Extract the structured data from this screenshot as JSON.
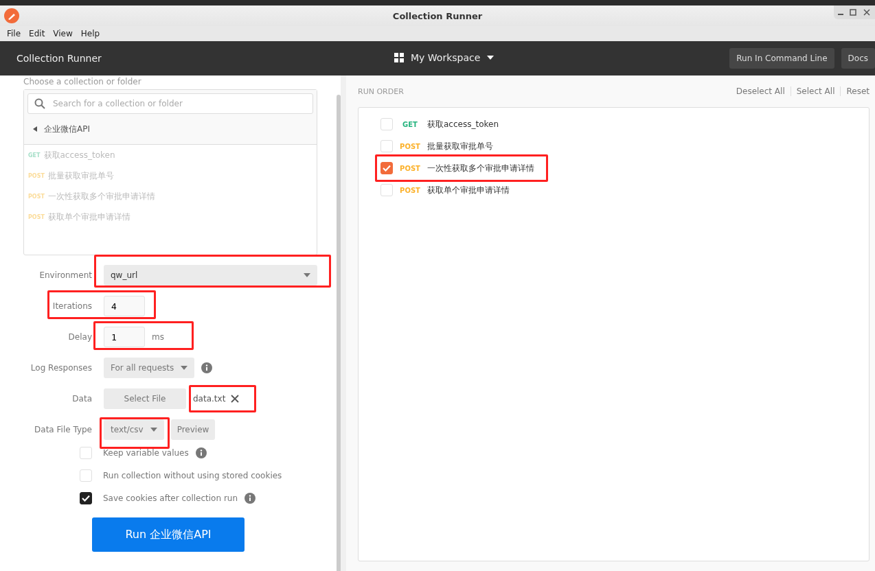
{
  "window": {
    "title": "Collection Runner"
  },
  "menu": [
    "File",
    "Edit",
    "View",
    "Help"
  ],
  "header": {
    "title": "Collection Runner",
    "workspace": "My Workspace",
    "buttons": [
      "Run In Command Line",
      "Docs"
    ]
  },
  "collection_picker": {
    "label": "Choose a collection or folder",
    "search_placeholder": "Search for a collection or folder",
    "collection": "企业微信API",
    "requests": [
      {
        "method": "GET",
        "name": "获取access_token"
      },
      {
        "method": "POST",
        "name": "批量获取审批单号"
      },
      {
        "method": "POST",
        "name": "一次性获取多个审批申请详情"
      },
      {
        "method": "POST",
        "name": "获取单个审批申请详情"
      }
    ]
  },
  "settings": [
    {
      "kind": "select",
      "label": "Environment",
      "value": "qw_url",
      "highlighted": true
    },
    {
      "kind": "number",
      "label": "Iterations",
      "value": "4",
      "highlighted": true
    },
    {
      "kind": "number",
      "label": "Delay",
      "value": "1",
      "unit": "ms",
      "highlighted": true
    },
    {
      "kind": "select_small",
      "label": "Log Responses",
      "value": "For all requests",
      "info": true,
      "highlighted": false
    },
    {
      "kind": "file",
      "label": "Data",
      "button": "Select File",
      "file": "data.txt",
      "highlighted": true
    },
    {
      "kind": "filetype",
      "label": "Data File Type",
      "value": "text/csv",
      "button": "Preview",
      "highlighted": true
    }
  ],
  "options": [
    {
      "label": "Keep variable values",
      "checked": false,
      "info": true
    },
    {
      "label": "Run collection without using stored cookies",
      "checked": false,
      "info": false
    },
    {
      "label": "Save cookies after collection run",
      "checked": true,
      "info": true
    }
  ],
  "run_button": "Run 企业微信API",
  "run_order": {
    "title": "RUN ORDER",
    "actions": [
      "Deselect All",
      "Select All",
      "Reset"
    ],
    "items": [
      {
        "method": "GET",
        "name": "获取access_token",
        "checked": false,
        "highlighted": false
      },
      {
        "method": "POST",
        "name": "批量获取审批单号",
        "checked": false,
        "highlighted": false
      },
      {
        "method": "POST",
        "name": "一次性获取多个审批申请详情",
        "checked": true,
        "highlighted": true
      },
      {
        "method": "POST",
        "name": "获取单个审批申请详情",
        "checked": false,
        "highlighted": false
      }
    ]
  }
}
